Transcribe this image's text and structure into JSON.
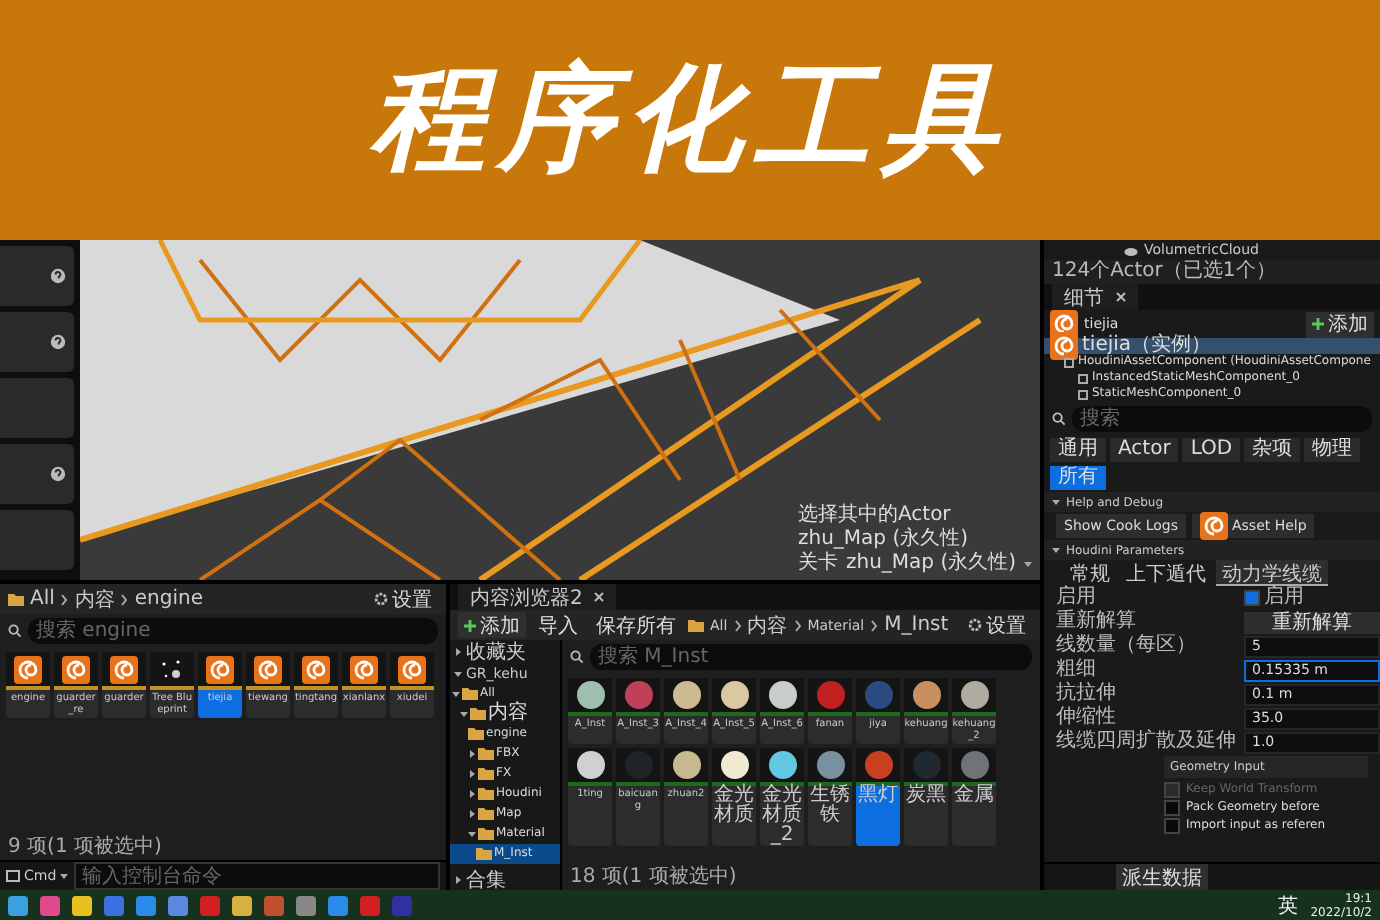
{
  "banner": {
    "title": "程序化工具"
  },
  "side_buttons": [
    {
      "kind": "help"
    },
    {
      "kind": "help"
    },
    {
      "kind": "blank"
    },
    {
      "kind": "help"
    },
    {
      "kind": "blank"
    }
  ],
  "viewport": {
    "info": [
      "选择其中的Actor",
      "zhu_Map (永久性)"
    ],
    "level_label": "关卡",
    "level_value": "zhu_Map (永久性)"
  },
  "outliner": {
    "items": [
      {
        "label": "VolumetricCloud"
      }
    ],
    "count": "124个Actor（已选1个）"
  },
  "details": {
    "tab": "细节",
    "actor": "tiejia",
    "add_button": "添加",
    "components": [
      {
        "label": "tiejia（实例）",
        "selected": true,
        "children": [
          {
            "label": "HoudiniAssetComponent (HoudiniAssetCompone",
            "selected": false,
            "children": [
              {
                "label": "InstancedStaticMeshComponent_0",
                "selected": false
              },
              {
                "label": "StaticMeshComponent_0",
                "selected": false
              }
            ]
          }
        ]
      }
    ],
    "search_placeholder": "搜索",
    "filters": [
      {
        "label": "通用",
        "selected": false
      },
      {
        "label": "Actor",
        "selected": false
      },
      {
        "label": "LOD",
        "selected": false
      },
      {
        "label": "杂项",
        "selected": false
      },
      {
        "label": "物理",
        "selected": false
      },
      {
        "label": "所有",
        "selected": true
      }
    ],
    "help_section": "Help and Debug",
    "help_buttons": [
      "Show Cook Logs",
      "Asset Help"
    ],
    "params_section": "Houdini Parameters",
    "param_tabs": [
      {
        "label": "常规",
        "selected": false
      },
      {
        "label": "上下遁代",
        "selected": false
      },
      {
        "label": "动力学线缆",
        "selected": true
      }
    ],
    "params": [
      {
        "kind": "checkbox",
        "label": "启用",
        "value": "启用",
        "checked": true
      },
      {
        "kind": "button",
        "label": "重新解算",
        "value": "重新解算"
      },
      {
        "kind": "field",
        "label": "线数量（每区）",
        "value": "5",
        "selected": false
      },
      {
        "kind": "field",
        "label": "粗细",
        "value": "0.15335 m",
        "selected": true
      },
      {
        "kind": "field",
        "label": "抗拉伸",
        "value": "0.1 m",
        "selected": false
      },
      {
        "kind": "field",
        "label": "伸缩性",
        "value": "35.0",
        "selected": false
      },
      {
        "kind": "field",
        "label": "线缆四周扩散及延伸",
        "value": "1.0",
        "selected": false
      }
    ],
    "input_type": "Geometry Input",
    "input_options": [
      {
        "label": "Keep World Transform",
        "checked": false,
        "disabled": true
      },
      {
        "label": "Pack Geometry before",
        "checked": false,
        "disabled": false
      },
      {
        "label": "Import input as referen",
        "checked": false,
        "disabled": false
      }
    ],
    "footer_button": "派生数据"
  },
  "browser1": {
    "path": [
      "All",
      "内容",
      "engine"
    ],
    "settings": "设置",
    "search_placeholder": "搜索 engine",
    "assets": [
      {
        "label": "engine",
        "kind": "houdini",
        "selected": false
      },
      {
        "label": "guarder_re",
        "kind": "houdini",
        "selected": false
      },
      {
        "label": "guarder",
        "kind": "houdini",
        "selected": false
      },
      {
        "label": "Tree Blueprint",
        "kind": "blueprint",
        "selected": false
      },
      {
        "label": "tiejia",
        "kind": "houdini",
        "selected": true
      },
      {
        "label": "tiewang",
        "kind": "houdini",
        "selected": false
      },
      {
        "label": "tingtang",
        "kind": "houdini",
        "selected": false
      },
      {
        "label": "xianlanx",
        "kind": "houdini",
        "selected": false
      },
      {
        "label": "xiudei",
        "kind": "houdini",
        "selected": false
      }
    ],
    "status": "9 项(1 项被选中)"
  },
  "console": {
    "label": "Cmd",
    "placeholder": "输入控制台命令"
  },
  "browser2": {
    "tab": "内容浏览器2",
    "add_button": "添加",
    "import_button": "导入",
    "save_button": "保存所有",
    "path": [
      "All",
      "内容",
      "Material",
      "M_Inst"
    ],
    "settings": "设置",
    "favorites": "收藏夹",
    "project": "GR_kehu",
    "tree": [
      {
        "label": "All",
        "expanded": true,
        "selected": false,
        "children": [
          {
            "label": "内容",
            "expanded": true,
            "selected": false,
            "children": [
              {
                "label": "engine",
                "selected": false
              },
              {
                "label": "FBX",
                "expanded": false,
                "selected": false
              },
              {
                "label": "FX",
                "expanded": false,
                "selected": false
              },
              {
                "label": "Houdini",
                "expanded": false,
                "selected": false
              },
              {
                "label": "Map",
                "expanded": false,
                "selected": false
              },
              {
                "label": "Material",
                "expanded": true,
                "selected": false,
                "children": [
                  {
                    "label": "M_Inst",
                    "selected": true
                  }
                ]
              }
            ]
          }
        ]
      }
    ],
    "collections": "合集",
    "search_placeholder": "搜索 M_Inst",
    "assets": [
      {
        "label": "A_Inst",
        "color": "#9fbfae",
        "selected": false
      },
      {
        "label": "A_Inst_3",
        "color": "#c0405a",
        "selected": false
      },
      {
        "label": "A_Inst_4",
        "color": "#cdbb90",
        "selected": false
      },
      {
        "label": "A_Inst_5",
        "color": "#d9c9a0",
        "selected": false
      },
      {
        "label": "A_Inst_6",
        "color": "#c8ccca",
        "selected": false
      },
      {
        "label": "fanan",
        "color": "#c02020",
        "selected": false
      },
      {
        "label": "jiya",
        "color": "#2a4a80",
        "selected": false
      },
      {
        "label": "kehuang",
        "color": "#c89060",
        "selected": false
      },
      {
        "label": "kehuang_2",
        "color": "#b0aaa0",
        "selected": false
      },
      {
        "label": "1ting",
        "color": "#d0d0d0",
        "selected": false
      },
      {
        "label": "baicuang",
        "color": "#202428",
        "selected": false
      },
      {
        "label": "zhuan2",
        "color": "#c8b890",
        "selected": false
      },
      {
        "label": "金光材质",
        "color": "#f0ead0",
        "selected": false
      },
      {
        "label": "金光材质_2",
        "color": "#60c8e0",
        "selected": false
      },
      {
        "label": "生锈铁",
        "color": "#7890a0",
        "selected": false
      },
      {
        "label": "黑灯",
        "color": "#c84020",
        "selected": true
      },
      {
        "label": "炭黑",
        "color": "#202830",
        "selected": false
      },
      {
        "label": "金属",
        "color": "#707478",
        "selected": false
      }
    ],
    "status": "18 项(1 项被选中)"
  },
  "taskbar": {
    "language": "英",
    "time": "19:1",
    "date": "2022/10/2"
  }
}
